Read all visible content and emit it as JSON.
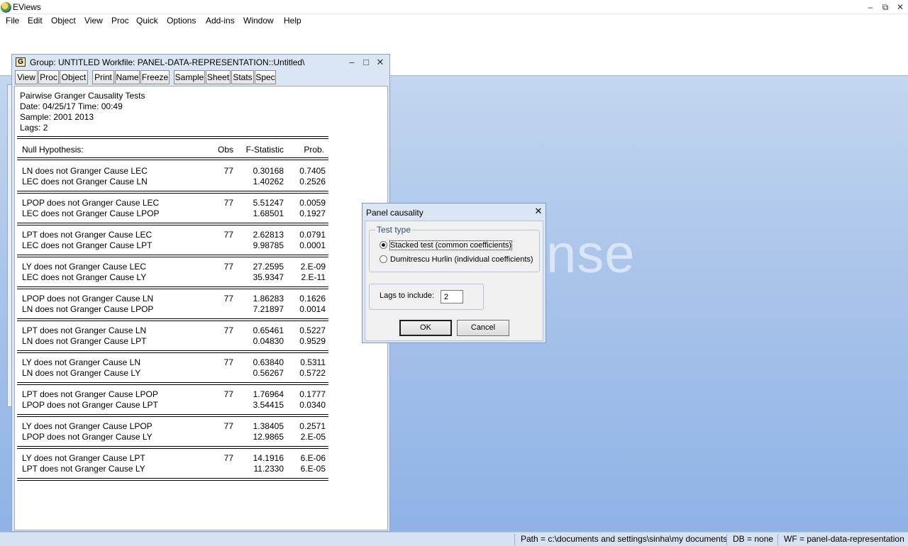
{
  "app": {
    "title": "EViews",
    "minimize": "–",
    "restore": "⧉",
    "close": "✕"
  },
  "menubar": [
    "File",
    "Edit",
    "Object",
    "View",
    "Proc",
    "Quick",
    "Options",
    "Add-ins",
    "Window",
    "Help"
  ],
  "workspace": {
    "watermark": "nse"
  },
  "group_window": {
    "icon_letter": "G",
    "title": "Group: UNTITLED   Workfile: PANEL-DATA-REPRESENTATION::Untitled\\",
    "toolbar": [
      "View",
      "Proc",
      "Object",
      "Print",
      "Name",
      "Freeze",
      "Sample",
      "Sheet",
      "Stats",
      "Spec"
    ],
    "output": {
      "heading": "Pairwise Granger Causality Tests",
      "date_line": "Date: 04/25/17   Time: 00:49",
      "sample_line": "Sample: 2001 2013",
      "lags_line": "Lags: 2",
      "columns": [
        "Null Hypothesis:",
        "Obs",
        "F-Statistic",
        "Prob."
      ],
      "pairs": [
        {
          "obs": "77",
          "rows": [
            {
              "h": "LN does not Granger Cause LEC",
              "f": "0.30168",
              "p": "0.7405"
            },
            {
              "h": "LEC does not Granger Cause LN",
              "f": "1.40262",
              "p": "0.2526"
            }
          ]
        },
        {
          "obs": "77",
          "rows": [
            {
              "h": "LPOP does not Granger Cause LEC",
              "f": "5.51247",
              "p": "0.0059"
            },
            {
              "h": "LEC does not Granger Cause LPOP",
              "f": "1.68501",
              "p": "0.1927"
            }
          ]
        },
        {
          "obs": "77",
          "rows": [
            {
              "h": "LPT does not Granger Cause LEC",
              "f": "2.62813",
              "p": "0.0791"
            },
            {
              "h": "LEC does not Granger Cause LPT",
              "f": "9.98785",
              "p": "0.0001"
            }
          ]
        },
        {
          "obs": "77",
          "rows": [
            {
              "h": "LY does not Granger Cause LEC",
              "f": "27.2595",
              "p": "2.E-09"
            },
            {
              "h": "LEC does not Granger Cause LY",
              "f": "35.9347",
              "p": "2.E-11"
            }
          ]
        },
        {
          "obs": "77",
          "rows": [
            {
              "h": "LPOP does not Granger Cause LN",
              "f": "1.86283",
              "p": "0.1626"
            },
            {
              "h": "LN does not Granger Cause LPOP",
              "f": "7.21897",
              "p": "0.0014"
            }
          ]
        },
        {
          "obs": "77",
          "rows": [
            {
              "h": "LPT does not Granger Cause LN",
              "f": "0.65461",
              "p": "0.5227"
            },
            {
              "h": "LN does not Granger Cause LPT",
              "f": "0.04830",
              "p": "0.9529"
            }
          ]
        },
        {
          "obs": "77",
          "rows": [
            {
              "h": "LY does not Granger Cause LN",
              "f": "0.63840",
              "p": "0.5311"
            },
            {
              "h": "LN does not Granger Cause LY",
              "f": "0.56267",
              "p": "0.5722"
            }
          ]
        },
        {
          "obs": "77",
          "rows": [
            {
              "h": "LPT does not Granger Cause LPOP",
              "f": "1.76964",
              "p": "0.1777"
            },
            {
              "h": "LPOP does not Granger Cause LPT",
              "f": "3.54415",
              "p": "0.0340"
            }
          ]
        },
        {
          "obs": "77",
          "rows": [
            {
              "h": "LY does not Granger Cause LPOP",
              "f": "1.38405",
              "p": "0.2571"
            },
            {
              "h": "LPOP does not Granger Cause LY",
              "f": "12.9865",
              "p": "2.E-05"
            }
          ]
        },
        {
          "obs": "77",
          "rows": [
            {
              "h": "LY does not Granger Cause LPT",
              "f": "14.1916",
              "p": "6.E-06"
            },
            {
              "h": "LPT does not Granger Cause LY",
              "f": "11.2330",
              "p": "6.E-05"
            }
          ]
        }
      ]
    }
  },
  "dialog": {
    "title": "Panel causality",
    "close": "✕",
    "test_type_label": "Test type",
    "options": [
      {
        "label": "Stacked test (common coefficients)",
        "checked": true
      },
      {
        "label": "Dumitrescu Hurlin (individual coefficients)",
        "checked": false
      }
    ],
    "lags_label": "Lags to include:",
    "lags_value": "2",
    "ok": "OK",
    "cancel": "Cancel"
  },
  "statusbar": {
    "path": "Path = c:\\documents and settings\\sinha\\my documents",
    "db": "DB = none",
    "wf": "WF = panel-data-representation"
  }
}
